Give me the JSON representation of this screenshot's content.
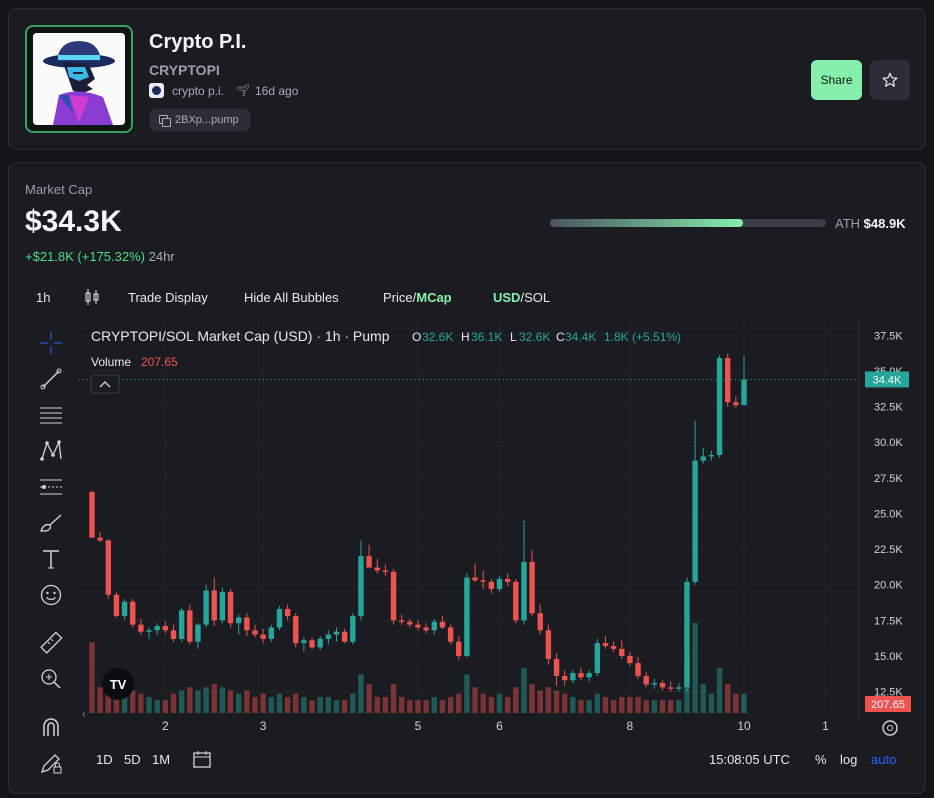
{
  "token": {
    "name": "Crypto P.I.",
    "ticker": "CRYPTOPI",
    "creator": "crypto p.i.",
    "age": "16d ago",
    "address": "2BXp...pump",
    "share_label": "Share"
  },
  "market": {
    "label": "Market Cap",
    "value": "$34.3K",
    "change_abs": "+$21.8K (+175.32%)",
    "change_period": "24hr",
    "ath_label": "ATH",
    "ath_value": "$48.9K",
    "ath_progress": 0.7
  },
  "toolbar": {
    "interval": "1h",
    "trade_display": "Trade Display",
    "hide_bubbles": "Hide All Bubbles",
    "price_label": "Price/",
    "mcap_label": "MCap",
    "usd_label": "USD",
    "sol_label": "/SOL"
  },
  "legend": {
    "title": "CRYPTOPI/SOL Market Cap (USD) · 1h · Pump",
    "o_label": "O",
    "o_value": "32.6K",
    "h_label": "H",
    "h_value": "36.1K",
    "l_label": "L",
    "l_value": "32.6K",
    "c_label": "C",
    "c_value": "34.4K",
    "change": "1.8K (+5.51%)",
    "volume_label": "Volume",
    "volume_value": "207.65"
  },
  "bottom": {
    "ranges": [
      "1D",
      "5D",
      "1M"
    ],
    "time": "15:08:05 UTC",
    "percent": "%",
    "log": "log",
    "auto": "auto"
  },
  "colors": {
    "up": "#26a69a",
    "down": "#ef5350",
    "accent": "#86efac",
    "auto": "#2962ff"
  },
  "chart_data": {
    "type": "candlestick",
    "title": "CRYPTOPI/SOL Market Cap (USD) · 1h · Pump",
    "ylim": [
      11000,
      38500
    ],
    "y_ticks": [
      "37.5K",
      "35.0K",
      "32.5K",
      "30.0K",
      "27.5K",
      "25.0K",
      "22.5K",
      "20.0K",
      "17.5K",
      "15.0K",
      "12.5K"
    ],
    "y_tick_values": [
      37500,
      35000,
      32500,
      30000,
      27500,
      25000,
      22500,
      20000,
      17500,
      15000,
      12500
    ],
    "x_ticks": [
      "2",
      "3",
      "5",
      "6",
      "8",
      "10",
      "1"
    ],
    "x_tick_index": [
      9,
      21,
      40,
      50,
      66,
      80,
      90
    ],
    "current_price_label": "34.4K",
    "current_price": 34400,
    "current_volume_label": "207.65",
    "candles": [
      [
        26500,
        26600,
        23300,
        23300,
        110
      ],
      [
        23300,
        23700,
        23000,
        23100,
        40
      ],
      [
        23100,
        23200,
        19000,
        19300,
        60
      ],
      [
        19300,
        19500,
        17700,
        17800,
        50
      ],
      [
        17800,
        19000,
        17500,
        18800,
        30
      ],
      [
        18800,
        19000,
        17000,
        17200,
        35
      ],
      [
        17200,
        17600,
        16500,
        16700,
        30
      ],
      [
        16700,
        17000,
        16200,
        16800,
        25
      ],
      [
        16800,
        17300,
        16500,
        17100,
        20
      ],
      [
        17100,
        17400,
        16600,
        16800,
        20
      ],
      [
        16800,
        17200,
        16000,
        16200,
        30
      ],
      [
        16200,
        18400,
        16000,
        18200,
        35
      ],
      [
        18200,
        18600,
        15800,
        16000,
        40
      ],
      [
        16000,
        17300,
        15500,
        17200,
        35
      ],
      [
        17200,
        20000,
        17000,
        19600,
        40
      ],
      [
        19600,
        20500,
        17100,
        17500,
        45
      ],
      [
        17500,
        19800,
        17300,
        19500,
        40
      ],
      [
        19500,
        19700,
        17000,
        17300,
        35
      ],
      [
        17300,
        17900,
        16500,
        17700,
        30
      ],
      [
        17700,
        18000,
        16400,
        16800,
        35
      ],
      [
        16800,
        17200,
        16300,
        16500,
        25
      ],
      [
        16500,
        16900,
        15900,
        16200,
        30
      ],
      [
        16200,
        17200,
        16000,
        17000,
        25
      ],
      [
        17000,
        18500,
        16800,
        18300,
        30
      ],
      [
        18300,
        18600,
        17500,
        17800,
        25
      ],
      [
        17800,
        18000,
        15600,
        15900,
        30
      ],
      [
        15900,
        16300,
        15300,
        16100,
        25
      ],
      [
        16100,
        16300,
        15500,
        15600,
        20
      ],
      [
        15600,
        16400,
        15400,
        16200,
        25
      ],
      [
        16200,
        16800,
        15800,
        16500,
        25
      ],
      [
        16500,
        17000,
        16000,
        16700,
        20
      ],
      [
        16700,
        16900,
        15900,
        16000,
        20
      ],
      [
        16000,
        18000,
        15800,
        17800,
        30
      ],
      [
        17800,
        23100,
        17500,
        22000,
        60
      ],
      [
        22000,
        22800,
        21500,
        21200,
        45
      ],
      [
        21200,
        21800,
        20800,
        21000,
        25
      ],
      [
        21000,
        21400,
        20600,
        20900,
        25
      ],
      [
        20900,
        21100,
        17200,
        17500,
        45
      ],
      [
        17500,
        17900,
        17200,
        17400,
        25
      ],
      [
        17400,
        17600,
        17000,
        17200,
        20
      ],
      [
        17200,
        17500,
        16800,
        17000,
        20
      ],
      [
        17000,
        17300,
        16600,
        16800,
        20
      ],
      [
        16800,
        17600,
        16500,
        17400,
        25
      ],
      [
        17400,
        17800,
        16900,
        17000,
        20
      ],
      [
        17000,
        17200,
        15800,
        16000,
        25
      ],
      [
        16000,
        16400,
        14700,
        15000,
        30
      ],
      [
        15000,
        20800,
        14900,
        20500,
        60
      ],
      [
        20500,
        21500,
        20200,
        20300,
        40
      ],
      [
        20300,
        21000,
        19700,
        20200,
        30
      ],
      [
        20200,
        20400,
        19400,
        19700,
        25
      ],
      [
        19700,
        20600,
        19500,
        20400,
        30
      ],
      [
        20400,
        20800,
        19900,
        20200,
        25
      ],
      [
        20200,
        20400,
        17300,
        17500,
        40
      ],
      [
        17500,
        24500,
        17200,
        21600,
        70
      ],
      [
        21600,
        22400,
        17800,
        18000,
        45
      ],
      [
        18000,
        18600,
        16500,
        16800,
        35
      ],
      [
        16800,
        17200,
        14400,
        14800,
        40
      ],
      [
        14800,
        15200,
        12900,
        13600,
        35
      ],
      [
        13600,
        14000,
        12900,
        13300,
        30
      ],
      [
        13300,
        14000,
        13100,
        13800,
        25
      ],
      [
        13800,
        14200,
        13300,
        13500,
        20
      ],
      [
        13500,
        14000,
        13200,
        13800,
        20
      ],
      [
        13800,
        16200,
        13600,
        15900,
        30
      ],
      [
        15900,
        16400,
        15500,
        15700,
        25
      ],
      [
        15700,
        16000,
        15300,
        15500,
        20
      ],
      [
        15500,
        16100,
        14800,
        15000,
        25
      ],
      [
        15000,
        15300,
        14300,
        14500,
        25
      ],
      [
        14500,
        14900,
        13400,
        13600,
        25
      ],
      [
        13600,
        13900,
        12800,
        13000,
        20
      ],
      [
        13000,
        13400,
        12700,
        13100,
        20
      ],
      [
        13100,
        13300,
        12600,
        12800,
        20
      ],
      [
        12800,
        13200,
        12500,
        12700,
        20
      ],
      [
        12700,
        13100,
        12500,
        12800,
        20
      ],
      [
        12800,
        20500,
        12500,
        20200,
        80
      ],
      [
        20200,
        31500,
        20000,
        28700,
        140
      ],
      [
        28700,
        29600,
        28500,
        29000,
        45
      ],
      [
        29000,
        29400,
        28700,
        29100,
        30
      ],
      [
        29100,
        36100,
        28900,
        35900,
        70
      ],
      [
        35900,
        36200,
        32500,
        32800,
        45
      ],
      [
        32800,
        33200,
        32400,
        32600,
        30
      ],
      [
        32600,
        36100,
        32600,
        34400,
        30
      ]
    ]
  }
}
